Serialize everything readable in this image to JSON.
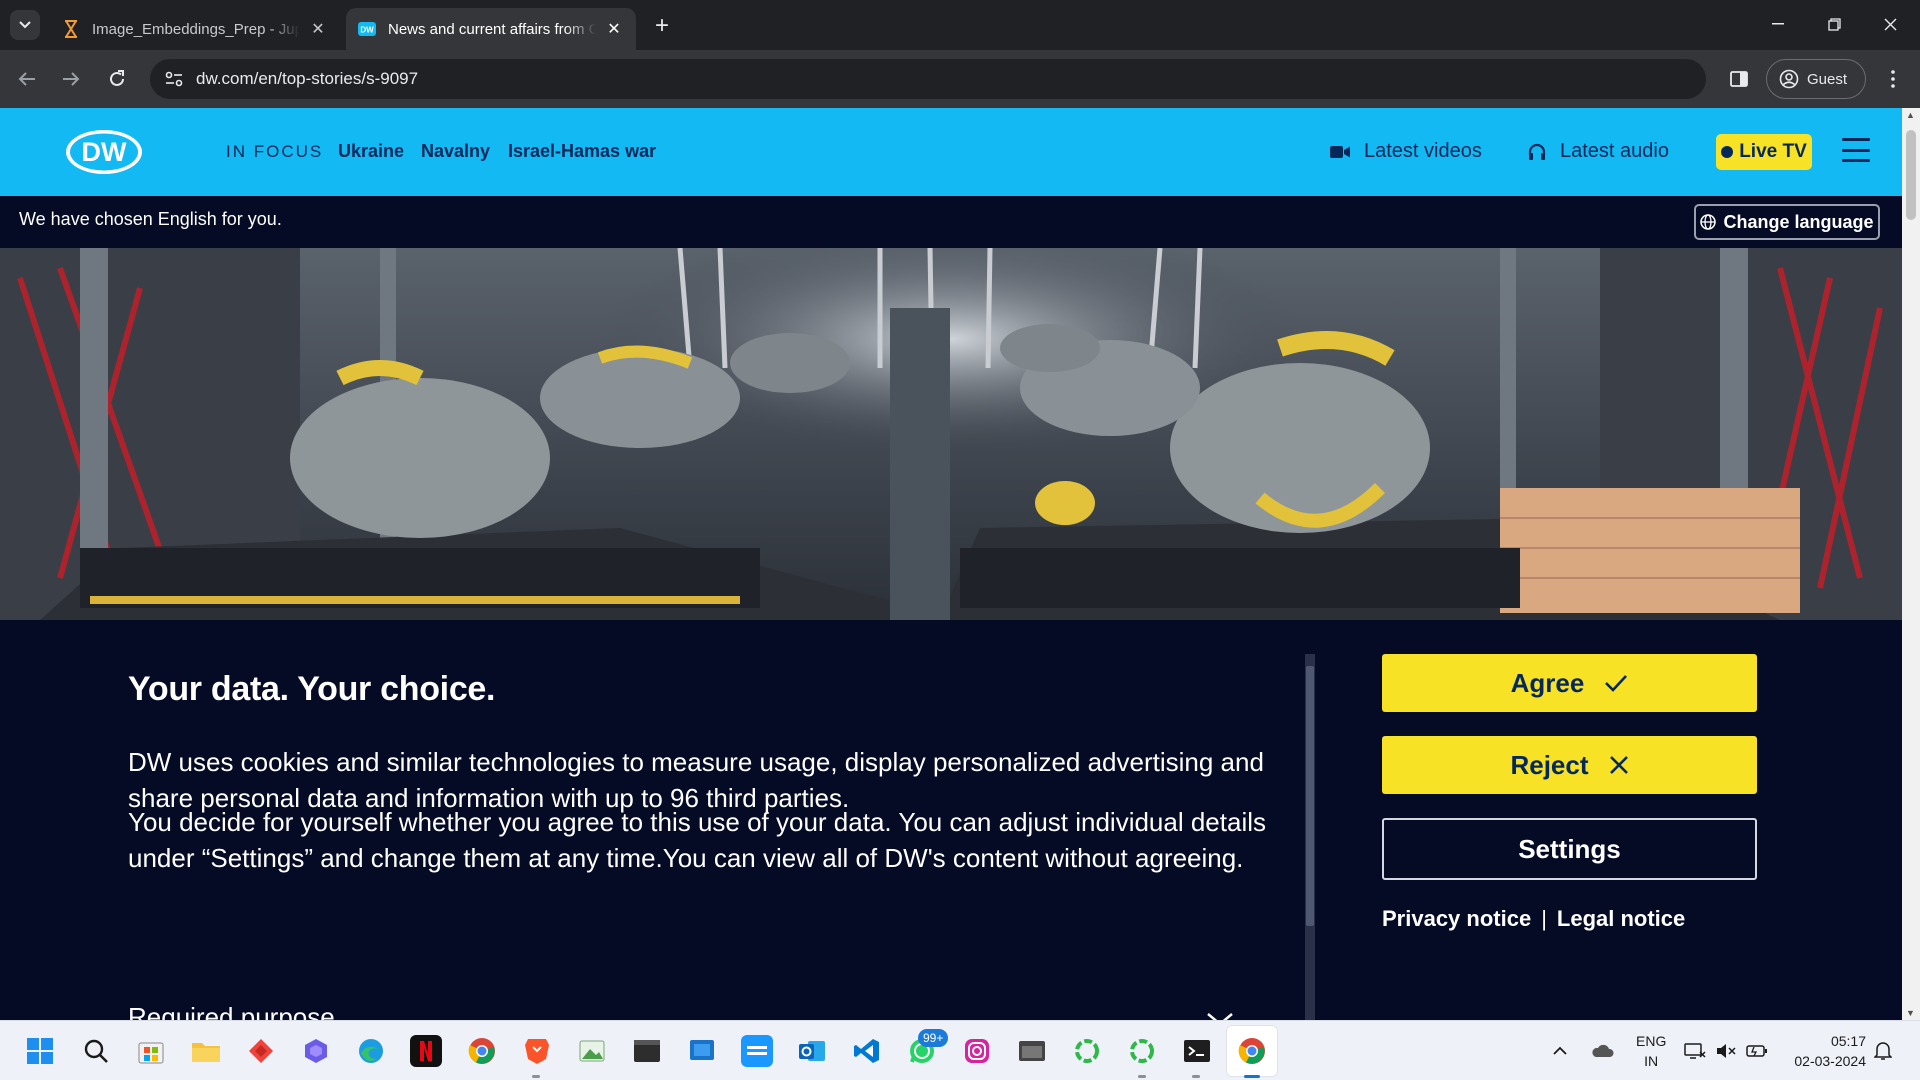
{
  "browser": {
    "tabs": [
      {
        "title": "Image_Embeddings_Prep - Jupyter"
      },
      {
        "title": "News and current affairs from Germany"
      }
    ],
    "address": "dw.com/en/top-stories/s-9097",
    "profile_label": "Guest"
  },
  "header": {
    "logo_text": "DW",
    "in_focus_label": "IN FOCUS",
    "focus_links": [
      "Ukraine",
      "Navalny",
      "Israel-Hamas war"
    ],
    "latest_videos": "Latest videos",
    "latest_audio": "Latest audio",
    "live_tv": "Live TV",
    "colors": {
      "header_bg": "#12b9f2",
      "nav_text": "#05285a",
      "accent_yellow": "#f7e226",
      "page_bg": "#050a25"
    }
  },
  "language_bar": {
    "message": "We have chosen English for you.",
    "button": "Change language"
  },
  "consent": {
    "title": "Your data. Your choice.",
    "paragraph1": "DW uses cookies and similar technologies to measure usage, display personalized advertising and share personal data and information with up to 96 third parties.",
    "paragraph2": "You decide for yourself whether you agree to this use of your data. You can adjust individual details under “Settings” and change them at any time.You can view all of DW's content without agreeing.",
    "required_purpose": "Required purpose",
    "agree": "Agree",
    "reject": "Reject",
    "settings": "Settings",
    "privacy_notice": "Privacy notice",
    "separator": "|",
    "legal_notice": "Legal notice"
  },
  "taskbar": {
    "whatsapp_badge": "99+",
    "tray_lang_line1": "ENG",
    "tray_lang_line2": "IN",
    "time": "05:17",
    "date": "02-03-2024",
    "icons": [
      "windows-start",
      "search",
      "microsoft-store",
      "file-explorer",
      "anydesk",
      "copilot",
      "edge",
      "netflix",
      "chrome",
      "brave",
      "image-viewer",
      "terminal-app",
      "windows-app",
      "prime-video",
      "outlook",
      "vscode",
      "whatsapp",
      "instagram",
      "window-manager",
      "loader-1",
      "loader-2",
      "command-prompt",
      "chrome-active"
    ]
  }
}
